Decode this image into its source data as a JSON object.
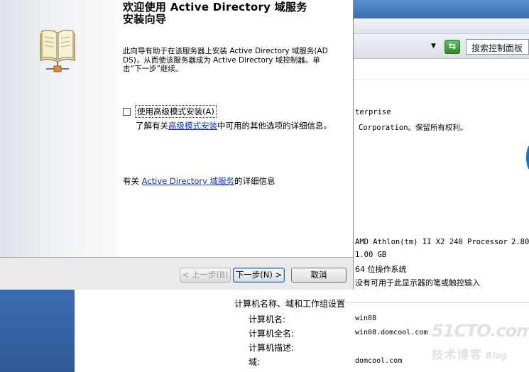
{
  "wizard": {
    "title_line1": "欢迎使用 Active Directory 域服务",
    "title_line2": "安装向导",
    "description": "此向导有助于在该服务器上安装 Active Directory 域服务(AD DS)，从而使该服务器成为 Active Directory 域控制器。单击“下一步”继续。",
    "advanced_checkbox_label": "使用高级模式安装(A)",
    "advanced_checked": false,
    "advanced_help_prefix": "了解有关",
    "advanced_help_link": "高级模式安装",
    "advanced_help_suffix": "中可用的其他选项的详细信息。",
    "ad_info_prefix": "有关 ",
    "ad_info_link": "Active Directory 域服务",
    "ad_info_suffix": "的详细信息",
    "buttons": {
      "back": "< 上一步(B)",
      "next": "下一步(N) >",
      "cancel": "取消"
    }
  },
  "background_window": {
    "search_placeholder": "搜索控制面板",
    "edition_fragment": "terprise",
    "copyright_fragment": "Corporation。保留所有权利。",
    "processor": "AMD Athlon(tm) II X2 240 Processor",
    "processor_speed": "2.80",
    "memory": "1.00 GB",
    "system_type": "64 位操作系统",
    "pen_touch": "没有可用于此显示器的笔或触控输入",
    "section_title": "计算机名称、域和工作组设置",
    "fields": [
      {
        "label": "计算机名:",
        "value": "win08"
      },
      {
        "label": "计算机全名:",
        "value": "win08.domcool.com"
      },
      {
        "label": "计算机描述:",
        "value": ""
      },
      {
        "label": "域:",
        "value": "domcool.com"
      }
    ]
  },
  "watermark": {
    "line1": "51CTO.com",
    "line2": "技术博客",
    "blog": "Blog"
  },
  "colors": {
    "desktop": "#2a5d9f",
    "link": "#0b36b5",
    "refresh_green": "#2e8a2a"
  }
}
